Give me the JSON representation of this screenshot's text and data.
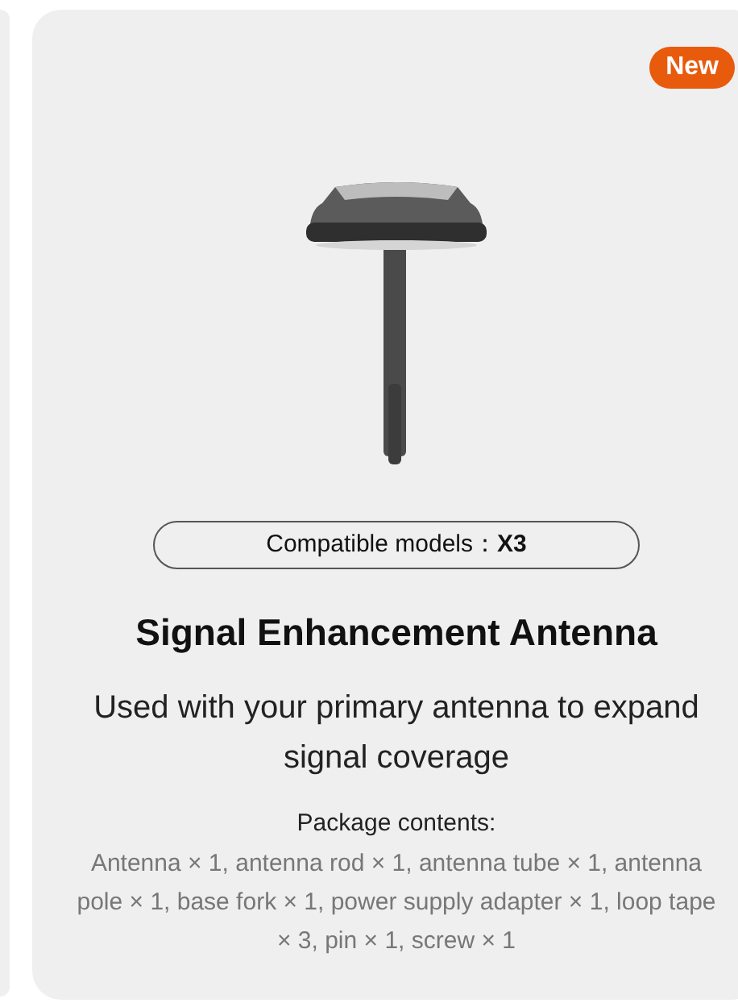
{
  "card": {
    "badge": "New",
    "compatibility": "Compatible models：**X3**",
    "title": "Signal Enhancement Antenna",
    "subtitle": "Used with your primary antenna to expand signal coverage",
    "package_heading": "Package contents:",
    "package_text": "Antenna × 1, antenna rod × 1, antenna tube × 1, antenna pole × 1, base fork × 1, power supply adapter × 1, loop tape × 3, pin × 1, screw × 1"
  }
}
